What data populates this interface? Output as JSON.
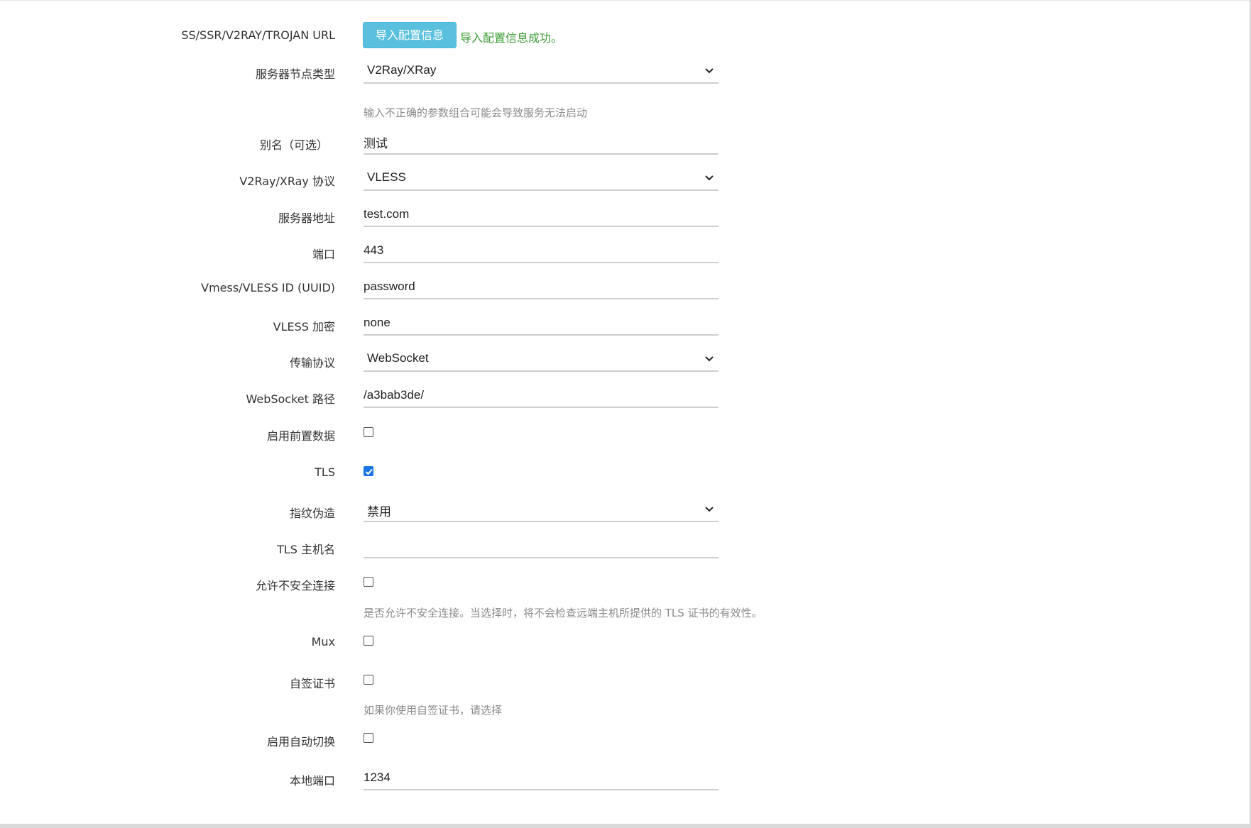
{
  "import": {
    "label": "SS/SSR/V2RAY/TROJAN URL",
    "button": "导入配置信息",
    "status": "导入配置信息成功。"
  },
  "server_type": {
    "label": "服务器节点类型",
    "value": "V2Ray/XRay",
    "hint": "输入不正确的参数组合可能会导致服务无法启动"
  },
  "alias": {
    "label": "别名（可选）",
    "value": "测试"
  },
  "protocol": {
    "label": "V2Ray/XRay 协议",
    "value": "VLESS"
  },
  "server": {
    "label": "服务器地址",
    "value": "test.com"
  },
  "port": {
    "label": "端口",
    "value": "443"
  },
  "uuid": {
    "label": "Vmess/VLESS ID (UUID)",
    "value": "password"
  },
  "vless_encryption": {
    "label": "VLESS 加密",
    "value": "none"
  },
  "transport": {
    "label": "传输协议",
    "value": "WebSocket"
  },
  "ws_path": {
    "label": "WebSocket 路径",
    "value": "/a3bab3de/"
  },
  "early_data": {
    "label": "启用前置数据",
    "checked": false
  },
  "tls": {
    "label": "TLS",
    "checked": true
  },
  "fingerprint": {
    "label": "指纹伪造",
    "value": "禁用"
  },
  "tls_host": {
    "label": "TLS 主机名",
    "value": ""
  },
  "insecure": {
    "label": "允许不安全连接",
    "checked": false,
    "hint": "是否允许不安全连接。当选择时，将不会检查远端主机所提供的 TLS 证书的有效性。"
  },
  "mux": {
    "label": "Mux",
    "checked": false
  },
  "self_signed": {
    "label": "自签证书",
    "checked": false,
    "hint": "如果你使用自签证书，请选择"
  },
  "auto_switch": {
    "label": "启用自动切换",
    "checked": false
  },
  "local_port": {
    "label": "本地端口",
    "value": "1234"
  },
  "colors": {
    "button": "#5bc0de",
    "success_text": "#3b9b34",
    "checkbox_checked": "#1a73e8"
  }
}
